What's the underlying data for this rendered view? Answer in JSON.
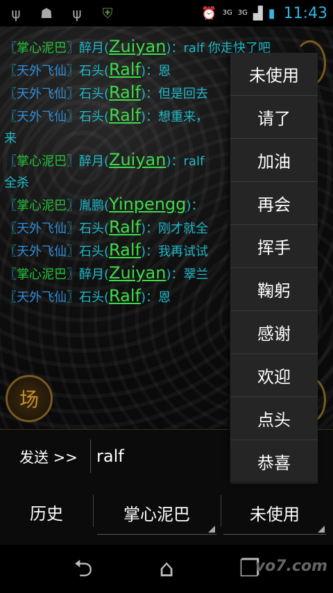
{
  "status_bar": {
    "left_icons": [
      "usb-icon",
      "android-debug-icon",
      "usb-icon",
      "shield-icon"
    ],
    "right_icons": [
      "alarm-icon",
      "3g-icon",
      "signal-icon",
      "battery-charging-icon"
    ],
    "network_small": "3G",
    "network_small2": "3G",
    "time": "11:43"
  },
  "chat": {
    "messages": [
      {
        "guild": "掌心泥巴",
        "guild_color": "g1",
        "speaker": "醉月",
        "username": "Zuiyan",
        "text": "：ralf 你走快了吧"
      },
      {
        "guild": "天外飞仙",
        "guild_color": "g2",
        "speaker": "石头",
        "username": "Ralf",
        "text": "：恩"
      },
      {
        "guild": "天外飞仙",
        "guild_color": "g2",
        "speaker": "石头",
        "username": "Ralf",
        "text": "：但是回去"
      },
      {
        "guild": "天外飞仙",
        "guild_color": "g2",
        "speaker": "石头",
        "username": "Ralf",
        "text": "：想重来，",
        "wrap_text": "来"
      },
      {
        "guild": "掌心泥巴",
        "guild_color": "g1",
        "speaker": "醉月",
        "username": "Zuiyan",
        "text": "：ralf",
        "wrap_text": "全杀"
      },
      {
        "guild": "掌心泥巴",
        "guild_color": "g1",
        "speaker": "胤鹏",
        "username": "Yinpengg",
        "text": "："
      },
      {
        "guild": "天外飞仙",
        "guild_color": "g2",
        "speaker": "石头",
        "username": "Ralf",
        "text": "：刚才就全"
      },
      {
        "guild": "天外飞仙",
        "guild_color": "g2",
        "speaker": "石头",
        "username": "Ralf",
        "text": "：我再试试"
      },
      {
        "guild": "掌心泥巴",
        "guild_color": "g1",
        "speaker": "醉月",
        "username": "Zuiyan",
        "text": "：翠兰"
      },
      {
        "guild": "天外飞仙",
        "guild_color": "g2",
        "speaker": "石头",
        "username": "Ralf",
        "text": "：恩"
      }
    ],
    "field_badge": "场"
  },
  "send_bar": {
    "label": "发送 >>",
    "input_value": "ralf"
  },
  "bottom_row": {
    "history_label": "历史",
    "channel_value": "掌心泥巴",
    "emote_value": "未使用"
  },
  "dropdown": {
    "items": [
      "未使用",
      "请了",
      "加油",
      "再会",
      "挥手",
      "鞠躬",
      "感谢",
      "欢迎",
      "点头",
      "恭喜"
    ]
  },
  "nav_bar": {
    "watermark": "vo7.com"
  }
}
